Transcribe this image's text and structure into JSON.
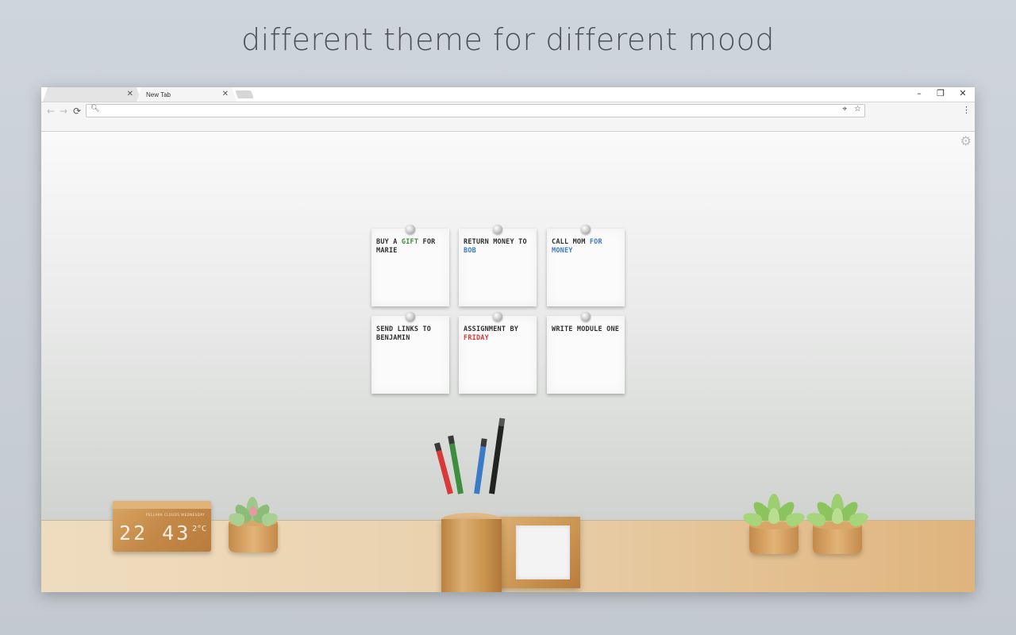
{
  "headline": "different theme for different mood",
  "browser": {
    "tabs": [
      {
        "title": "",
        "close": "✕"
      },
      {
        "title": "New Tab",
        "close": "✕"
      }
    ],
    "window_controls": {
      "minimize": "–",
      "maximize": "❐",
      "close": "✕"
    },
    "toolbar": {
      "back": "←",
      "forward": "→",
      "reload": "⟳",
      "omnibox_value": "",
      "menu": "⋮"
    }
  },
  "notes": [
    {
      "parts": [
        {
          "t": "BUY A "
        },
        {
          "t": "GIFT",
          "c": "green"
        },
        {
          "t": " FOR MARIE"
        }
      ]
    },
    {
      "parts": [
        {
          "t": "RETURN MONEY TO "
        },
        {
          "t": "BOB",
          "c": "blue"
        }
      ]
    },
    {
      "parts": [
        {
          "t": "CALL MOM "
        },
        {
          "t": "FOR MONEY",
          "c": "blue"
        }
      ]
    },
    {
      "parts": [
        {
          "t": "SEND LINKS TO BENJAMIN"
        }
      ]
    },
    {
      "parts": [
        {
          "t": "ASSIGNMENT BY "
        },
        {
          "t": "FRIDAY",
          "c": "red"
        }
      ]
    },
    {
      "parts": [
        {
          "t": "WRITE MODULE ONE"
        }
      ]
    }
  ],
  "clock": {
    "info": "PELLAKA CLOUDS WEDNESDAY",
    "time": "22 43",
    "temp": "2°C"
  },
  "colors": {
    "highlight_green": "#3c8f3c",
    "highlight_blue": "#3a7bc8",
    "highlight_red": "#d43a3a"
  },
  "icons": {
    "settings": "gear-icon",
    "search": "search-icon",
    "location": "location-icon",
    "bookmark": "star-icon"
  }
}
